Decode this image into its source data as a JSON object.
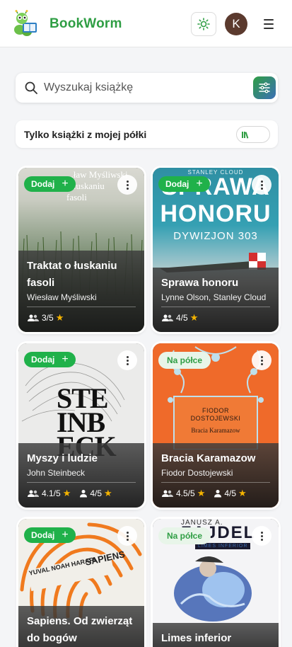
{
  "app": {
    "brand": "BookWorm",
    "avatar_initial": "K",
    "accent": "#2f9e44"
  },
  "search": {
    "placeholder": "Wyszukaj książkę"
  },
  "filter": {
    "shelf_only_label": "Tylko książki z mojej półki"
  },
  "books": [
    {
      "title": "Traktat o łuskaniu fasoli",
      "author": "Wiesław Myśliwski",
      "badge": "Dodaj",
      "community_rating": "3/5",
      "cover_text": [
        "...ław Myśliwski",
        "o łuskaniu",
        "fasoli"
      ]
    },
    {
      "title": "Sprawa honoru",
      "author": "Lynne Olson, Stanley Cloud",
      "badge": "Dodaj",
      "community_rating": "4/5",
      "cover_text": [
        "STANLEY CLOUD",
        "SPRAWA",
        "HONORU",
        "DYWIZJON 303"
      ]
    },
    {
      "title": "Myszy i ludzie",
      "author": "John Steinbeck",
      "badge": "Dodaj",
      "community_rating": "4.1/5",
      "user_rating": "4/5",
      "cover_text": [
        "STE",
        "INB",
        "ECK"
      ]
    },
    {
      "title": "Bracia Karamazow",
      "author": "Fiodor Dostojewski",
      "badge": "Na półce",
      "community_rating": "4.5/5",
      "user_rating": "4/5",
      "cover_text": [
        "FIODOR",
        "DOSTOJEWSKI",
        "Bracia Karamazow"
      ]
    },
    {
      "title": "Sapiens. Od zwierząt do bogów",
      "author": "",
      "badge": "Dodaj",
      "cover_text": [
        "YUVAL NOAH HARARI",
        "SAPIENS"
      ]
    },
    {
      "title": "Limes inferior",
      "author": "",
      "badge": "Na półce",
      "cover_text": [
        "JANUSZ A.",
        "ZAJDEL",
        "LIMES INFERIOR"
      ]
    }
  ]
}
